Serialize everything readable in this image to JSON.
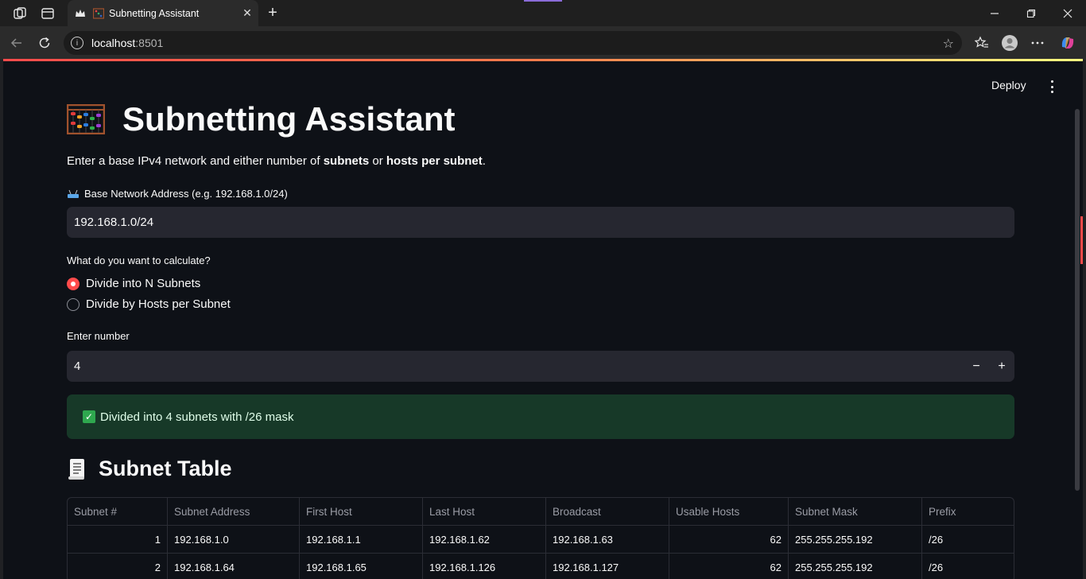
{
  "browser": {
    "tab_title": "Subnetting Assistant",
    "url_host": "localhost",
    "url_port": ":8501"
  },
  "app": {
    "deploy_label": "Deploy",
    "title": "Subnetting Assistant",
    "intro": {
      "prefix": "Enter a base IPv4 network and either number of ",
      "bold1": "subnets",
      "mid": " or ",
      "bold2": "hosts per subnet",
      "suffix": "."
    },
    "network_label": "Base Network Address (e.g. 192.168.1.0/24)",
    "network_value": "192.168.1.0/24",
    "calc_label": "What do you want to calculate?",
    "options": [
      "Divide into N Subnets",
      "Divide by Hosts per Subnet"
    ],
    "selected_option": 0,
    "number_label": "Enter number",
    "number_value": "4",
    "stepper_minus": "−",
    "stepper_plus": "+",
    "success_message": "Divided into 4 subnets with /26 mask",
    "table_title": "Subnet Table",
    "table": {
      "headers": [
        "Subnet #",
        "Subnet Address",
        "First Host",
        "Last Host",
        "Broadcast",
        "Usable Hosts",
        "Subnet Mask",
        "Prefix"
      ],
      "rows": [
        [
          "1",
          "192.168.1.0",
          "192.168.1.1",
          "192.168.1.62",
          "192.168.1.63",
          "62",
          "255.255.255.192",
          "/26"
        ],
        [
          "2",
          "192.168.1.64",
          "192.168.1.65",
          "192.168.1.126",
          "192.168.1.127",
          "62",
          "255.255.255.192",
          "/26"
        ]
      ]
    }
  },
  "colors": {
    "accent": "#ff4b4b",
    "success_bg": "#173928",
    "app_bg": "#0e1117",
    "input_bg": "#262730"
  }
}
